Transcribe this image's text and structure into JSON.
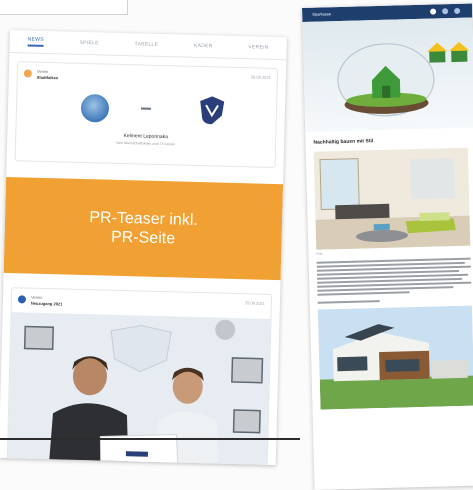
{
  "left_app": {
    "tabs": [
      "NEWS",
      "SPIELE",
      "TABELLE",
      "KADER",
      "VEREIN"
    ],
    "post1": {
      "author": "Verein",
      "subtitle": "Stadtfalken",
      "date": "28.08.2021",
      "match_name": "Kelment Leporinaka",
      "match_sub": "Vom Mannschaftskreis zum TV-Verein"
    },
    "teaser": {
      "line1": "PR-Teaser inkl.",
      "line2": "PR-Seite"
    },
    "post2": {
      "author": "Verein",
      "subtitle": "Neuzugang 2021",
      "date": "25.08.2021"
    }
  },
  "right_app": {
    "title": "Sparkasse",
    "headline": "Nachhaltig bauen mit Stil",
    "caption": "Foto"
  },
  "colors": {
    "teaser": "#f1a133",
    "appbar": "#1e3f6e",
    "tab_active": "#3a66b5"
  }
}
